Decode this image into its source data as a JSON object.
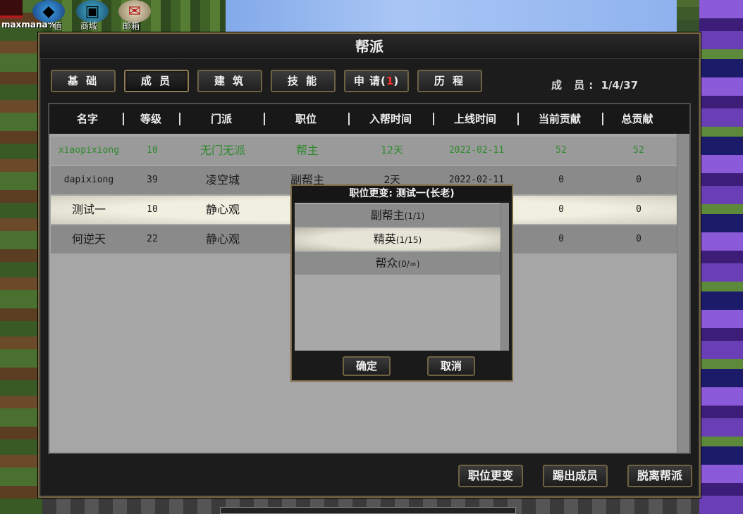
{
  "hud": {
    "maxmana_label": "maxmana%",
    "icons": [
      {
        "name": "crystal-icon",
        "label": "值"
      },
      {
        "name": "gift-icon",
        "label": "商城"
      },
      {
        "name": "mail-icon",
        "label": "邮箱"
      }
    ]
  },
  "panel": {
    "title": "帮派",
    "tabs": [
      {
        "label": "基 础"
      },
      {
        "label": "成 员",
        "active": true
      },
      {
        "label": "建 筑"
      },
      {
        "label": "技 能"
      },
      {
        "label_prefix": "申 请(",
        "badge": "1",
        "label_suffix": ")"
      },
      {
        "label": "历 程"
      }
    ],
    "member_count_label": "成 员:",
    "member_count_value": "1/4/37"
  },
  "table": {
    "headers": [
      "名字",
      "等级",
      "门派",
      "职位",
      "入帮时间",
      "上线时间",
      "当前贡献",
      "总贡献"
    ],
    "rows": [
      {
        "name": "xiaopixiong",
        "level": "10",
        "sect": "无门无派",
        "position": "帮主",
        "joined": "12天",
        "online": "2022-02-11",
        "current": "52",
        "total": "52"
      },
      {
        "name": "dapixiong",
        "level": "39",
        "sect": "凌空城",
        "position": "副帮主",
        "joined": "2天",
        "online": "2022-02-11",
        "current": "0",
        "total": "0"
      },
      {
        "name": "测试一",
        "level": "10",
        "sect": "静心观",
        "position": "",
        "joined": "",
        "online": "",
        "current": "0",
        "total": "0"
      },
      {
        "name": "何逆天",
        "level": "22",
        "sect": "静心观",
        "position": "",
        "joined": "",
        "online": "",
        "current": "0",
        "total": "0"
      }
    ]
  },
  "actions": {
    "change_position": "职位更变",
    "kick_member": "踢出成员",
    "leave_guild": "脱离帮派"
  },
  "dialog": {
    "title": "职位更变: 测试一(长老)",
    "options": [
      {
        "label": "副帮主",
        "count": "(1/1)"
      },
      {
        "label": "精英",
        "count": "(1/15)",
        "selected": true
      },
      {
        "label": "帮众",
        "count": "(0/∞)"
      }
    ],
    "confirm": "确定",
    "cancel": "取消"
  },
  "colors": {
    "leader_text": "#2d8a2d",
    "badge_red": "#ff3030",
    "frame_gold": "#7c6a45"
  }
}
